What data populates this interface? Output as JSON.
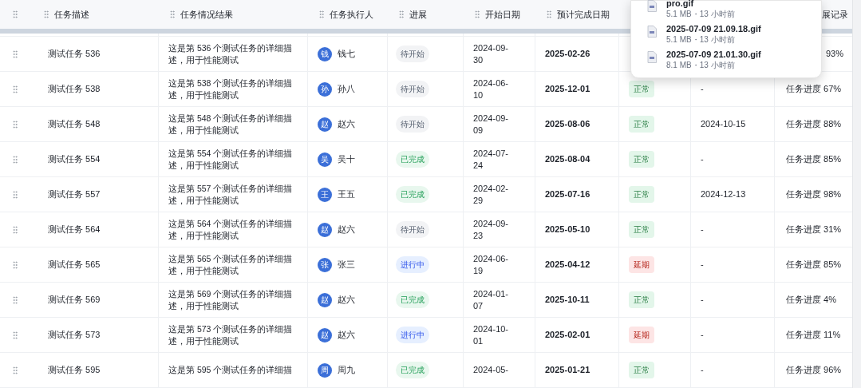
{
  "table": {
    "columns": [
      "任务描述",
      "任务情况结果",
      "任务执行人",
      "进展",
      "开始日期",
      "预计完成日期",
      {
        "label": "展记录",
        "partial": true
      }
    ],
    "rows": [
      {
        "name": "测试任务 536",
        "description": "这是第 536 个测试任务的详细描述，用于性能测试",
        "avatar": "钱",
        "executor": "钱七",
        "progress": {
          "label": "待开始",
          "kind": "pending"
        },
        "start": "2024-09-30",
        "planned": "2025-02-26",
        "record": {
          "text": "93%",
          "partial": true
        }
      },
      {
        "name": "测试任务 538",
        "description": "这是第 538 个测试任务的详细描述，用于性能测试",
        "avatar": "孙",
        "executor": "孙八",
        "progress": {
          "label": "待开始",
          "kind": "pending"
        },
        "start": "2024-06-10",
        "planned": "2025-12-01",
        "status": {
          "label": "正常",
          "kind": "normal"
        },
        "actual": "-",
        "record": {
          "text": "任务进度 67%",
          "partial": false
        }
      },
      {
        "name": "测试任务 548",
        "description": "这是第 548 个测试任务的详细描述，用于性能测试",
        "avatar": "赵",
        "executor": "赵六",
        "progress": {
          "label": "待开始",
          "kind": "pending"
        },
        "start": "2024-09-09",
        "planned": "2025-08-06",
        "status": {
          "label": "正常",
          "kind": "normal"
        },
        "actual": "2024-10-15",
        "record": {
          "text": "任务进度 88%",
          "partial": false
        }
      },
      {
        "name": "测试任务 554",
        "description": "这是第 554 个测试任务的详细描述，用于性能测试",
        "avatar": "吴",
        "executor": "吴十",
        "progress": {
          "label": "已完成",
          "kind": "done"
        },
        "start": "2024-07-24",
        "planned": "2025-08-04",
        "status": {
          "label": "正常",
          "kind": "normal"
        },
        "actual": "-",
        "record": {
          "text": "任务进度 85%",
          "partial": false
        }
      },
      {
        "name": "测试任务 557",
        "description": "这是第 557 个测试任务的详细描述，用于性能测试",
        "avatar": "王",
        "executor": "王五",
        "progress": {
          "label": "已完成",
          "kind": "done"
        },
        "start": "2024-02-29",
        "planned": "2025-07-16",
        "status": {
          "label": "正常",
          "kind": "normal"
        },
        "actual": "2024-12-13",
        "record": {
          "text": "任务进度 98%",
          "partial": false
        }
      },
      {
        "name": "测试任务 564",
        "description": "这是第 564 个测试任务的详细描述，用于性能测试",
        "avatar": "赵",
        "executor": "赵六",
        "progress": {
          "label": "待开始",
          "kind": "pending"
        },
        "start": "2024-09-23",
        "planned": "2025-05-10",
        "status": {
          "label": "正常",
          "kind": "normal"
        },
        "actual": "-",
        "record": {
          "text": "任务进度 31%",
          "partial": false
        }
      },
      {
        "name": "测试任务 565",
        "description": "这是第 565 个测试任务的详细描述，用于性能测试",
        "avatar": "张",
        "executor": "张三",
        "progress": {
          "label": "进行中",
          "kind": "active"
        },
        "start": "2024-06-19",
        "planned": "2025-04-12",
        "status": {
          "label": "延期",
          "kind": "delayed"
        },
        "actual": "-",
        "record": {
          "text": "任务进度 85%",
          "partial": false
        }
      },
      {
        "name": "测试任务 569",
        "description": "这是第 569 个测试任务的详细描述，用于性能测试",
        "avatar": "赵",
        "executor": "赵六",
        "progress": {
          "label": "已完成",
          "kind": "done"
        },
        "start": "2024-01-07",
        "planned": "2025-10-11",
        "status": {
          "label": "正常",
          "kind": "normal"
        },
        "actual": "-",
        "record": {
          "text": "任务进度 4%",
          "partial": false
        }
      },
      {
        "name": "测试任务 573",
        "description": "这是第 573 个测试任务的详细描述，用于性能测试",
        "avatar": "赵",
        "executor": "赵六",
        "progress": {
          "label": "进行中",
          "kind": "active"
        },
        "start": "2024-10-01",
        "planned": "2025-02-01",
        "status": {
          "label": "延期",
          "kind": "delayed"
        },
        "actual": "-",
        "record": {
          "text": "任务进度 11%",
          "partial": false
        }
      },
      {
        "name": "测试任务 595",
        "description": "这是第 595 个测试任务的详细描",
        "avatar": "周",
        "executor": "周九",
        "progress": {
          "label": "已完成",
          "kind": "done"
        },
        "start": "2024-05-",
        "planned": "2025-01-21",
        "status": {
          "label": "正常",
          "kind": "normal"
        },
        "actual": "-",
        "record": {
          "text": "任务进度 96%",
          "partial": false
        }
      }
    ]
  },
  "downloads": [
    {
      "name": "pro.gif",
      "meta": "5.1 MB・13 小时前"
    },
    {
      "name": "2025-07-09 21.09.18.gif",
      "meta": "5.1 MB・13 小时前"
    },
    {
      "name": "2025-07-09 21.01.30.gif",
      "meta": "8.1 MB・13 小时前"
    }
  ]
}
